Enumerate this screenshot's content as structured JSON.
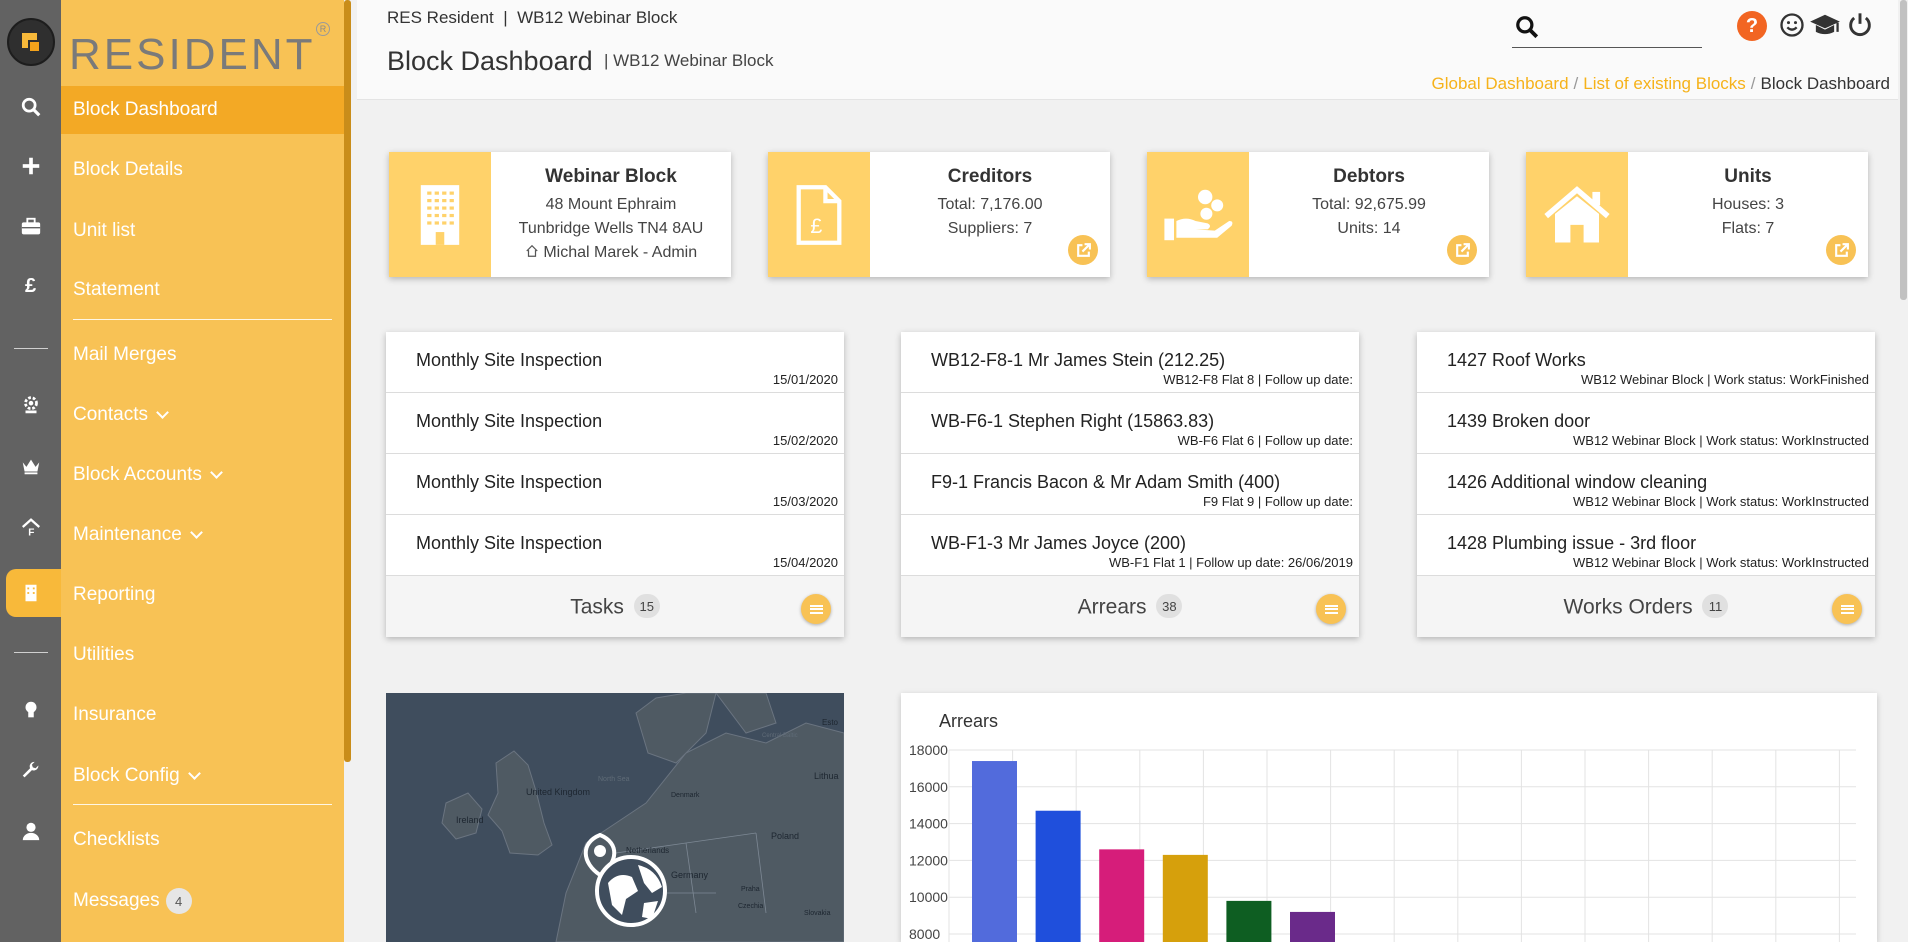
{
  "brand": {
    "name": "RESIDENT",
    "reg": "R"
  },
  "header": {
    "context": "RES Resident  |  WB12 Webinar Block",
    "title": "Block Dashboard",
    "subtitle": "| WB12 Webinar Block",
    "search_placeholder": "",
    "help_label": "?",
    "breadcrumb": {
      "item1": "Global Dashboard",
      "item2": "List of existing Blocks",
      "current": "Block Dashboard",
      "sep": "/"
    }
  },
  "menu": {
    "block_dashboard": "Block Dashboard",
    "block_details": "Block Details",
    "unit_list": "Unit list",
    "statement": "Statement",
    "mail_merges": "Mail Merges",
    "contacts": "Contacts",
    "block_accounts": "Block Accounts",
    "maintenance": "Maintenance",
    "reporting": "Reporting",
    "utilities": "Utilities",
    "insurance": "Insurance",
    "block_config": "Block Config",
    "checklists": "Checklists",
    "messages": "Messages",
    "messages_count": "4"
  },
  "cards": {
    "block": {
      "title": "Webinar Block",
      "line1": "48 Mount Ephraim",
      "line2": "Tunbridge Wells TN4 8AU",
      "line3": "Michal Marek - Admin"
    },
    "creditors": {
      "title": "Creditors",
      "line1": "Total: 7,176.00",
      "line2": "Suppliers: 7"
    },
    "debtors": {
      "title": "Debtors",
      "line1": "Total: 92,675.99",
      "line2": "Units: 14"
    },
    "units": {
      "title": "Units",
      "line1": "Houses: 3",
      "line2": "Flats: 7"
    }
  },
  "tasks": {
    "label": "Tasks",
    "count": "15",
    "rows": [
      {
        "title": "Monthly Site Inspection",
        "sub": "15/01/2020"
      },
      {
        "title": "Monthly Site Inspection",
        "sub": "15/02/2020"
      },
      {
        "title": "Monthly Site Inspection",
        "sub": "15/03/2020"
      },
      {
        "title": "Monthly Site Inspection",
        "sub": "15/04/2020"
      }
    ]
  },
  "arrears": {
    "label": "Arrears",
    "count": "38",
    "rows": [
      {
        "title": "WB12-F8-1 Mr James Stein (212.25)",
        "sub": "WB12-F8 Flat 8 | Follow up date:"
      },
      {
        "title": "WB-F6-1 Stephen Right (15863.83)",
        "sub": "WB-F6 Flat 6 | Follow up date:"
      },
      {
        "title": "F9-1 Francis Bacon & Mr Adam Smith (400)",
        "sub": "F9 Flat 9 | Follow up date:"
      },
      {
        "title": "WB-F1-3 Mr James Joyce (200)",
        "sub": "WB-F1 Flat 1 | Follow up date: 26/06/2019"
      }
    ]
  },
  "works": {
    "label": "Works Orders",
    "count": "11",
    "rows": [
      {
        "title": "1427 Roof Works",
        "sub": "WB12 Webinar Block | Work status: WorkFinished"
      },
      {
        "title": "1439 Broken door",
        "sub": "WB12 Webinar Block | Work status: WorkInstructed"
      },
      {
        "title": "1426 Additional window cleaning",
        "sub": "WB12 Webinar Block | Work status: WorkInstructed"
      },
      {
        "title": "1428 Plumbing issue - 3rd floor",
        "sub": "WB12 Webinar Block | Work status: WorkInstructed"
      }
    ]
  },
  "map": {
    "labels": [
      "United Kingdom",
      "Ireland",
      "North Sea",
      "Denmark",
      "Netherlands",
      "Germany",
      "Poland",
      "Praha",
      "Czechia",
      "Slovakia",
      "Lithua",
      "Esto",
      "Central Baltic"
    ]
  },
  "chart_data": {
    "type": "bar",
    "title": "Arrears",
    "yticks": [
      "18000",
      "16000",
      "14000",
      "12000",
      "10000",
      "8000"
    ],
    "ylim": [
      8000,
      18000
    ],
    "grid": true,
    "values": [
      17400,
      14700,
      12600,
      12300,
      9800,
      9200
    ],
    "colors": [
      "#526bdc",
      "#1f4fdc",
      "#d61d7a",
      "#d6a00c",
      "#0e5e22",
      "#6a2a8a"
    ]
  },
  "colors": {
    "accent": "#f8c255",
    "accent_dark": "#f3a925",
    "rail": "#626262",
    "help": "#f26522",
    "link": "#f6b21a"
  }
}
